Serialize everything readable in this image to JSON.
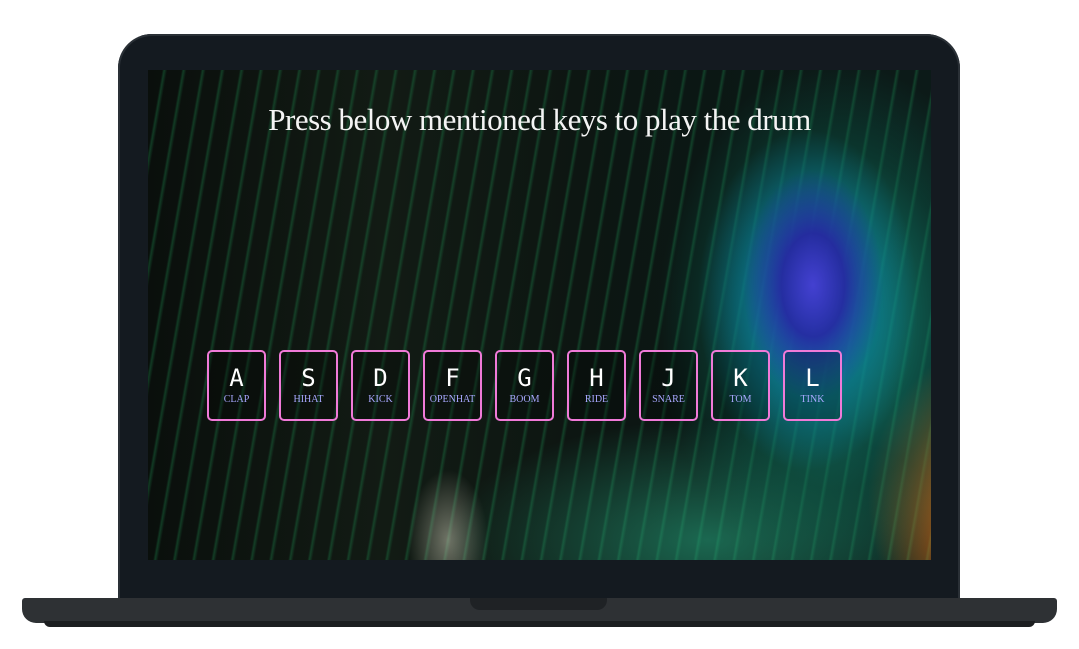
{
  "screen": {
    "title": "Press below mentioned keys to play the drum"
  },
  "keys": [
    {
      "letter": "A",
      "sound": "clap"
    },
    {
      "letter": "S",
      "sound": "hihat"
    },
    {
      "letter": "D",
      "sound": "kick"
    },
    {
      "letter": "F",
      "sound": "openhat"
    },
    {
      "letter": "G",
      "sound": "boom"
    },
    {
      "letter": "H",
      "sound": "ride"
    },
    {
      "letter": "J",
      "sound": "snare"
    },
    {
      "letter": "K",
      "sound": "tom"
    },
    {
      "letter": "L",
      "sound": "tink"
    }
  ],
  "colors": {
    "key_border": "#f07ad8",
    "key_sound_text": "#a8a8ff",
    "laptop_frame": "#141a20",
    "laptop_base": "#2e3134"
  }
}
